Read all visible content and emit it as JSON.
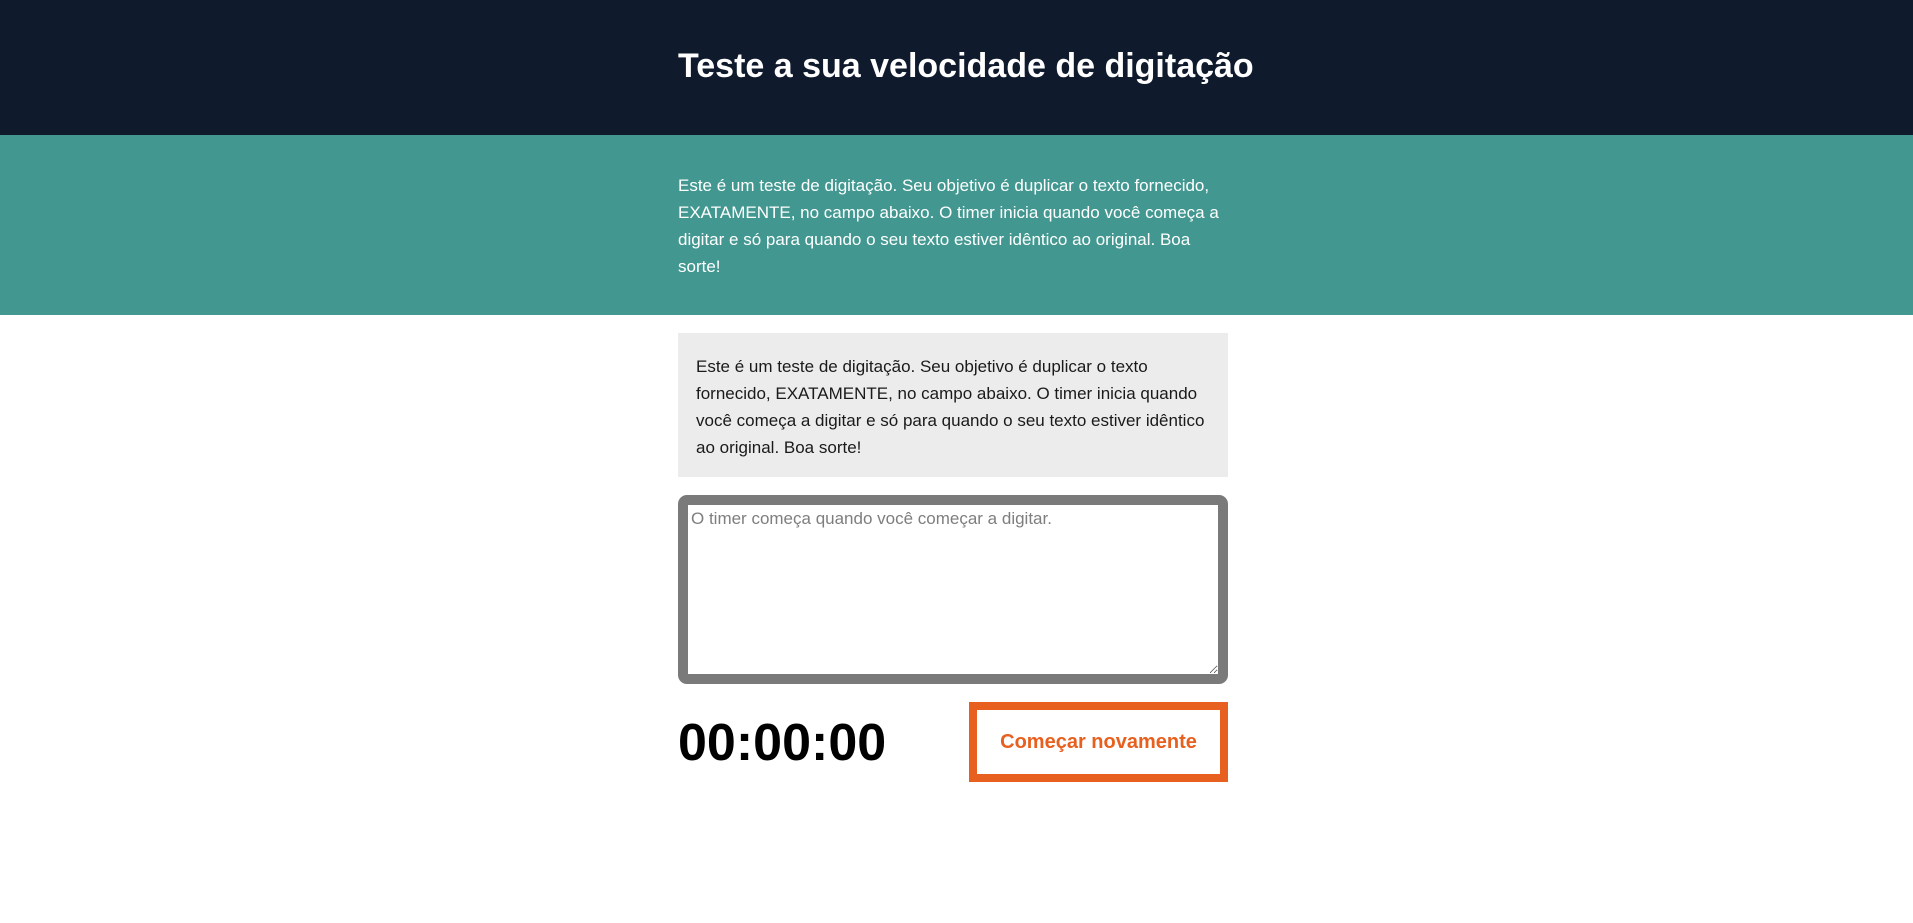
{
  "header": {
    "title": "Teste a sua velocidade de digitação"
  },
  "intro": {
    "text": "Este é um teste de digitação. Seu objetivo é duplicar o texto fornecido, EXATAMENTE, no campo abaixo. O timer inicia quando você começa a digitar e só para quando o seu texto estiver idêntico ao original. Boa sorte!"
  },
  "origin": {
    "text": "Este é um teste de digitação. Seu objetivo é duplicar o texto fornecido, EXATAMENTE, no campo abaixo. O timer inicia quando você começa a digitar e só para quando o seu texto estiver idêntico ao original. Boa sorte!"
  },
  "test_area": {
    "value": "",
    "placeholder": "O timer começa quando você começar a digitar."
  },
  "timer": {
    "value": "00:00:00"
  },
  "reset_button": {
    "label": "Começar novamente"
  },
  "colors": {
    "header_bg": "#0f1b2d",
    "intro_bg": "#429890",
    "origin_bg": "#ececec",
    "textarea_border": "#7a7a7a",
    "accent": "#e8601f"
  }
}
